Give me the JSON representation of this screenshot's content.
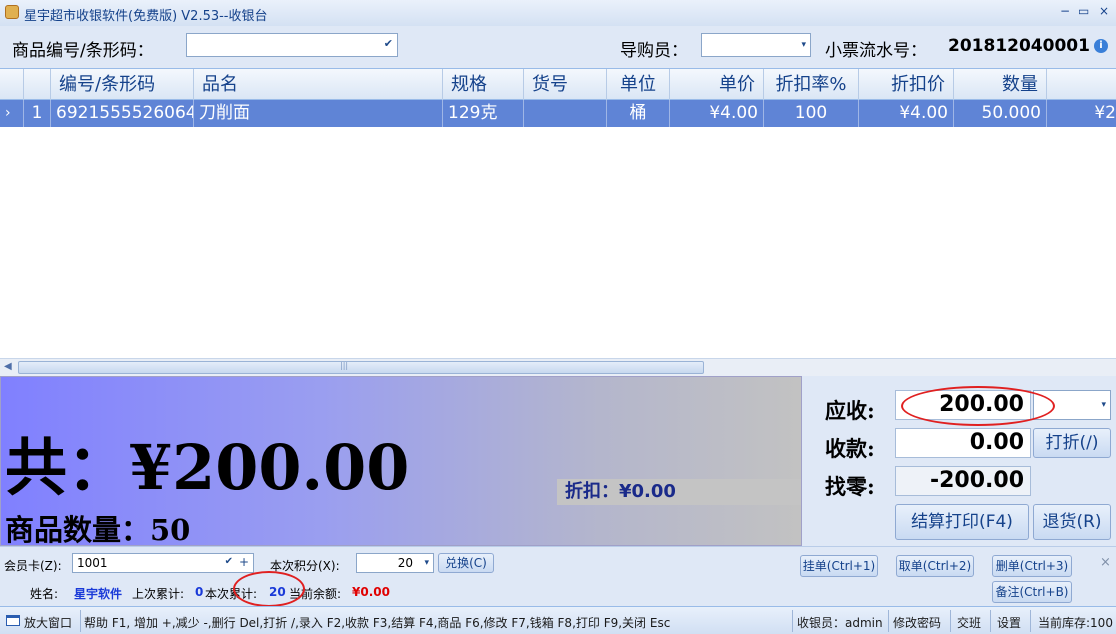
{
  "window": {
    "title": "星宇超市收银软件(免费版) V2.53--收银台",
    "controls": [
      "−",
      "▭",
      "×"
    ]
  },
  "search": {
    "barcode_label": "商品编号/条形码：",
    "barcode_value": "",
    "salesperson_label": "导购员：",
    "salesperson_value": "",
    "receipt_label": "小票流水号：",
    "receipt_number": "201812040001"
  },
  "grid": {
    "columns": [
      "编号/条形码",
      "品名",
      "规格",
      "货号",
      "单位",
      "单价",
      "折扣率%",
      "折扣价",
      "数量"
    ],
    "rows": [
      {
        "marker": "›",
        "index": "1",
        "code": "6921555526064",
        "name": "刀削面",
        "spec": "129克",
        "item_no": "",
        "unit": "桶",
        "price": "¥4.00",
        "discount_rate": "100",
        "discount_price": "¥4.00",
        "quantity": "50.000",
        "amount": "¥2"
      }
    ]
  },
  "summary": {
    "total_label": "共：¥200.00",
    "quantity_label": "商品数量：50",
    "discount_label": "折扣：¥0.00"
  },
  "payment": {
    "due_label": "应收:",
    "due_value": "200.00",
    "received_label": "收款:",
    "received_value": "0.00",
    "change_label": "找零:",
    "change_value": "-200.00",
    "discount_button": "打折(/)",
    "checkout_button": "结算打印(F4)",
    "refund_button": "退货(R)"
  },
  "member": {
    "card_label": "会员卡(Z):",
    "card_value": "1001",
    "points_label": "本次积分(X):",
    "points_value": "20",
    "exchange_button": "兑换(C)",
    "name_label": "姓名:",
    "name_value": "星宇软件",
    "last_total_label": "上次累计:",
    "last_total_value": "0",
    "this_total_label": "本次累计:",
    "this_total_value": "20",
    "balance_label": "当前余额:",
    "balance_value": "¥0.00"
  },
  "actions": {
    "hold": "挂单(Ctrl+1)",
    "retrieve": "取单(Ctrl+2)",
    "delete": "删单(Ctrl+3)",
    "note": "备注(Ctrl+B)",
    "close": "×"
  },
  "status": {
    "enlarge": "放大窗口",
    "help": "帮助 F1, 增加 +,减少 -,删行 Del,打折 /,录入 F2,收款 F3,结算 F4,商品 F6,修改 F7,钱箱 F8,打印 F9,关闭 Esc",
    "cashier": "收银员：admin",
    "change_password": "修改密码",
    "shift": "交班",
    "settings": "设置",
    "stock": "当前库存:100"
  },
  "colors": {
    "accent": "#15428b",
    "selected_row": "#5f84d6",
    "highlight_circle": "#e02020",
    "balance_red": "#e00000",
    "member_blue": "#1a3ad8"
  }
}
